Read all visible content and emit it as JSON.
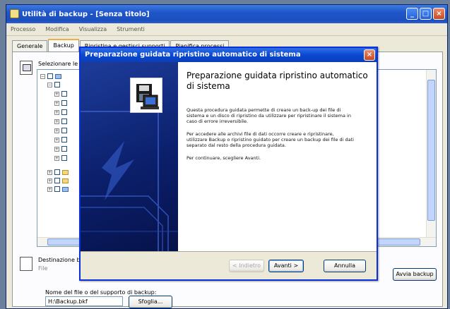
{
  "main_window": {
    "title": "Utilità di backup - [Senza titolo]",
    "menu": [
      "Processo",
      "Modifica",
      "Visualizza",
      "Strumenti"
    ],
    "tabs": [
      "Generale",
      "Backup",
      "Ripristina e gestisci supporti",
      "Pianifica processi"
    ],
    "selection_label": "Selezionare le caselle di controllo",
    "destination_label": "Destinazione backup:",
    "destination_value": "File",
    "backup_name_label": "Nome del file o del supporto di backup:",
    "backup_name_value": "H:\\Backup.bkf",
    "browse_button": "Sfoglia...",
    "start_button": "Avvia backup"
  },
  "wizard": {
    "title": "Preparazione guidata ripristino automatico di sistema",
    "heading": "Preparazione guidata ripristino automatico di sistema",
    "paragraph1": "Questa procedura guidata permette di creare un back-up dei file di sistema e un disco di ripristino da utilizzare per ripristinare il sistema in caso di errore irreversibile.",
    "paragraph2": "Per accedere alle archivi file di dati occorre creare e ripristinare, utilizzare Backup o ripristino guidato per creare un backup dei file di dati separato dal resto della procedura guidata.",
    "paragraph3": "Per continuare, scegliere Avanti.",
    "back_button": "< Indietro",
    "next_button": "Avanti >",
    "cancel_button": "Annulla"
  },
  "icons": {
    "wizard_logo": "backup-floppy-computer-icon",
    "window_close": "close-icon"
  },
  "colors": {
    "title_bar": "#1f56c9",
    "wizard_side": "#0b1f6b",
    "dialog_face": "#ece9d8"
  }
}
